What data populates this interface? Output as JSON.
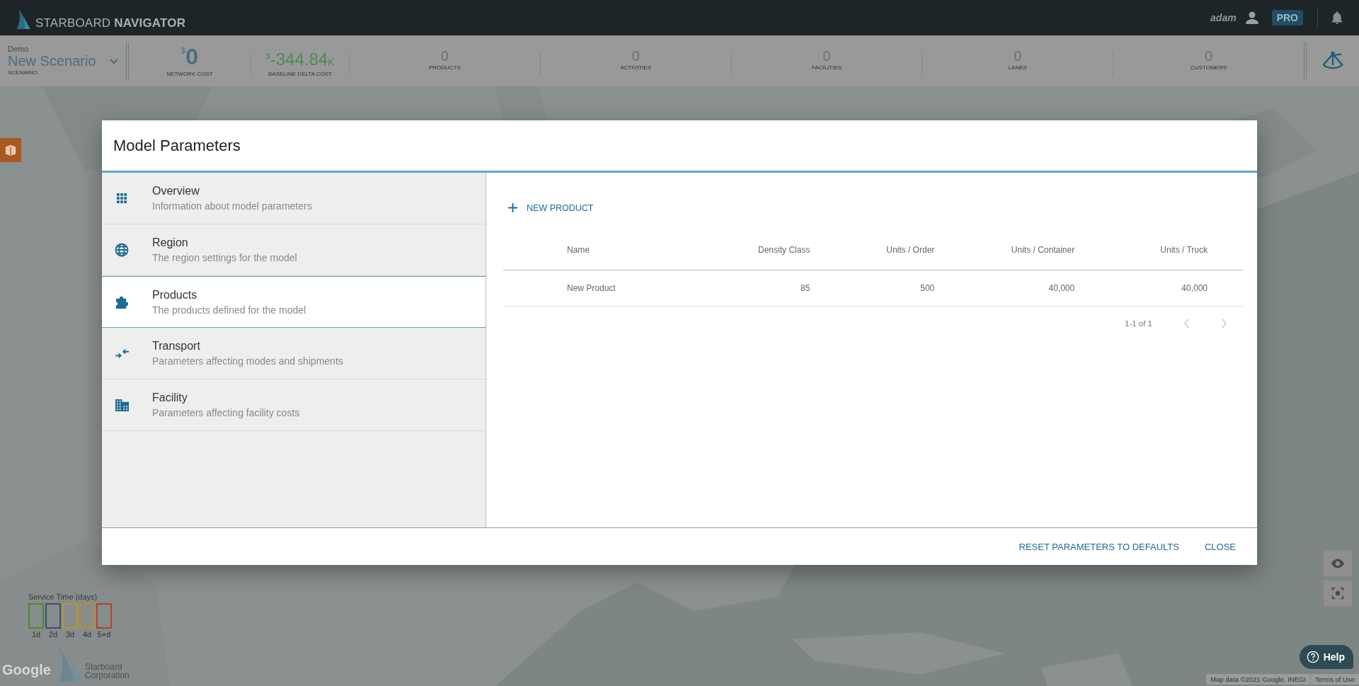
{
  "app_bar": {
    "brand_light": "STARBOARD",
    "brand_bold": "NAVIGATOR",
    "user": "adam",
    "plan_badge": "PRO"
  },
  "scenario": {
    "group": "Demo",
    "name": "New Scenario",
    "caption": "SCENARIO"
  },
  "costs": [
    {
      "currency": "$",
      "value": "0",
      "label": "NETWORK COST",
      "kind": "neutral"
    },
    {
      "currency": "$",
      "value": "-344.84",
      "unit": "K",
      "label": "BASELINE DELTA COST",
      "kind": "gain"
    }
  ],
  "counts": [
    {
      "value": "0",
      "label": "PRODUCTS"
    },
    {
      "value": "0",
      "label": "ACTIVITIES"
    },
    {
      "value": "0",
      "label": "FACILITIES"
    },
    {
      "value": "0",
      "label": "LANES"
    },
    {
      "value": "0",
      "label": "CUSTOMERS"
    }
  ],
  "dialog": {
    "title": "Model Parameters",
    "sections": [
      {
        "title": "Overview",
        "description": "Information about model parameters",
        "selected": false
      },
      {
        "title": "Region",
        "description": "The region settings for the model",
        "selected": false
      },
      {
        "title": "Products",
        "description": "The products defined for the model",
        "selected": true
      },
      {
        "title": "Transport",
        "description": "Parameters affecting modes and shipments",
        "selected": false
      },
      {
        "title": "Facility",
        "description": "Parameters affecting facility costs",
        "selected": false
      }
    ],
    "new_button": "NEW PRODUCT",
    "table": {
      "columns": [
        "Name",
        "Density Class",
        "Units / Order",
        "Units / Container",
        "Units / Truck"
      ],
      "rows": [
        [
          "New Product",
          "85",
          "500",
          "40,000",
          "40,000"
        ]
      ]
    },
    "pagination": "1-1 of 1",
    "buttons": [
      "RESET PARAMETERS TO DEFAULTS",
      "CLOSE"
    ]
  },
  "map": {
    "legend": {
      "title": "Service Time (days)",
      "items": [
        {
          "label": "1d",
          "color": "#4a8a2a"
        },
        {
          "label": "2d",
          "color": "#3c5070"
        },
        {
          "label": "3d",
          "color": "#b8963a"
        },
        {
          "label": "4d",
          "color": "#c08a38"
        },
        {
          "label": "5+d",
          "color": "#b0442a"
        }
      ]
    },
    "google": "Google",
    "watermark": [
      "Starboard",
      "Corporation"
    ],
    "help": "Help",
    "attribution": "Map data ©2021 Google, INEGI",
    "terms": "Terms of Use"
  }
}
